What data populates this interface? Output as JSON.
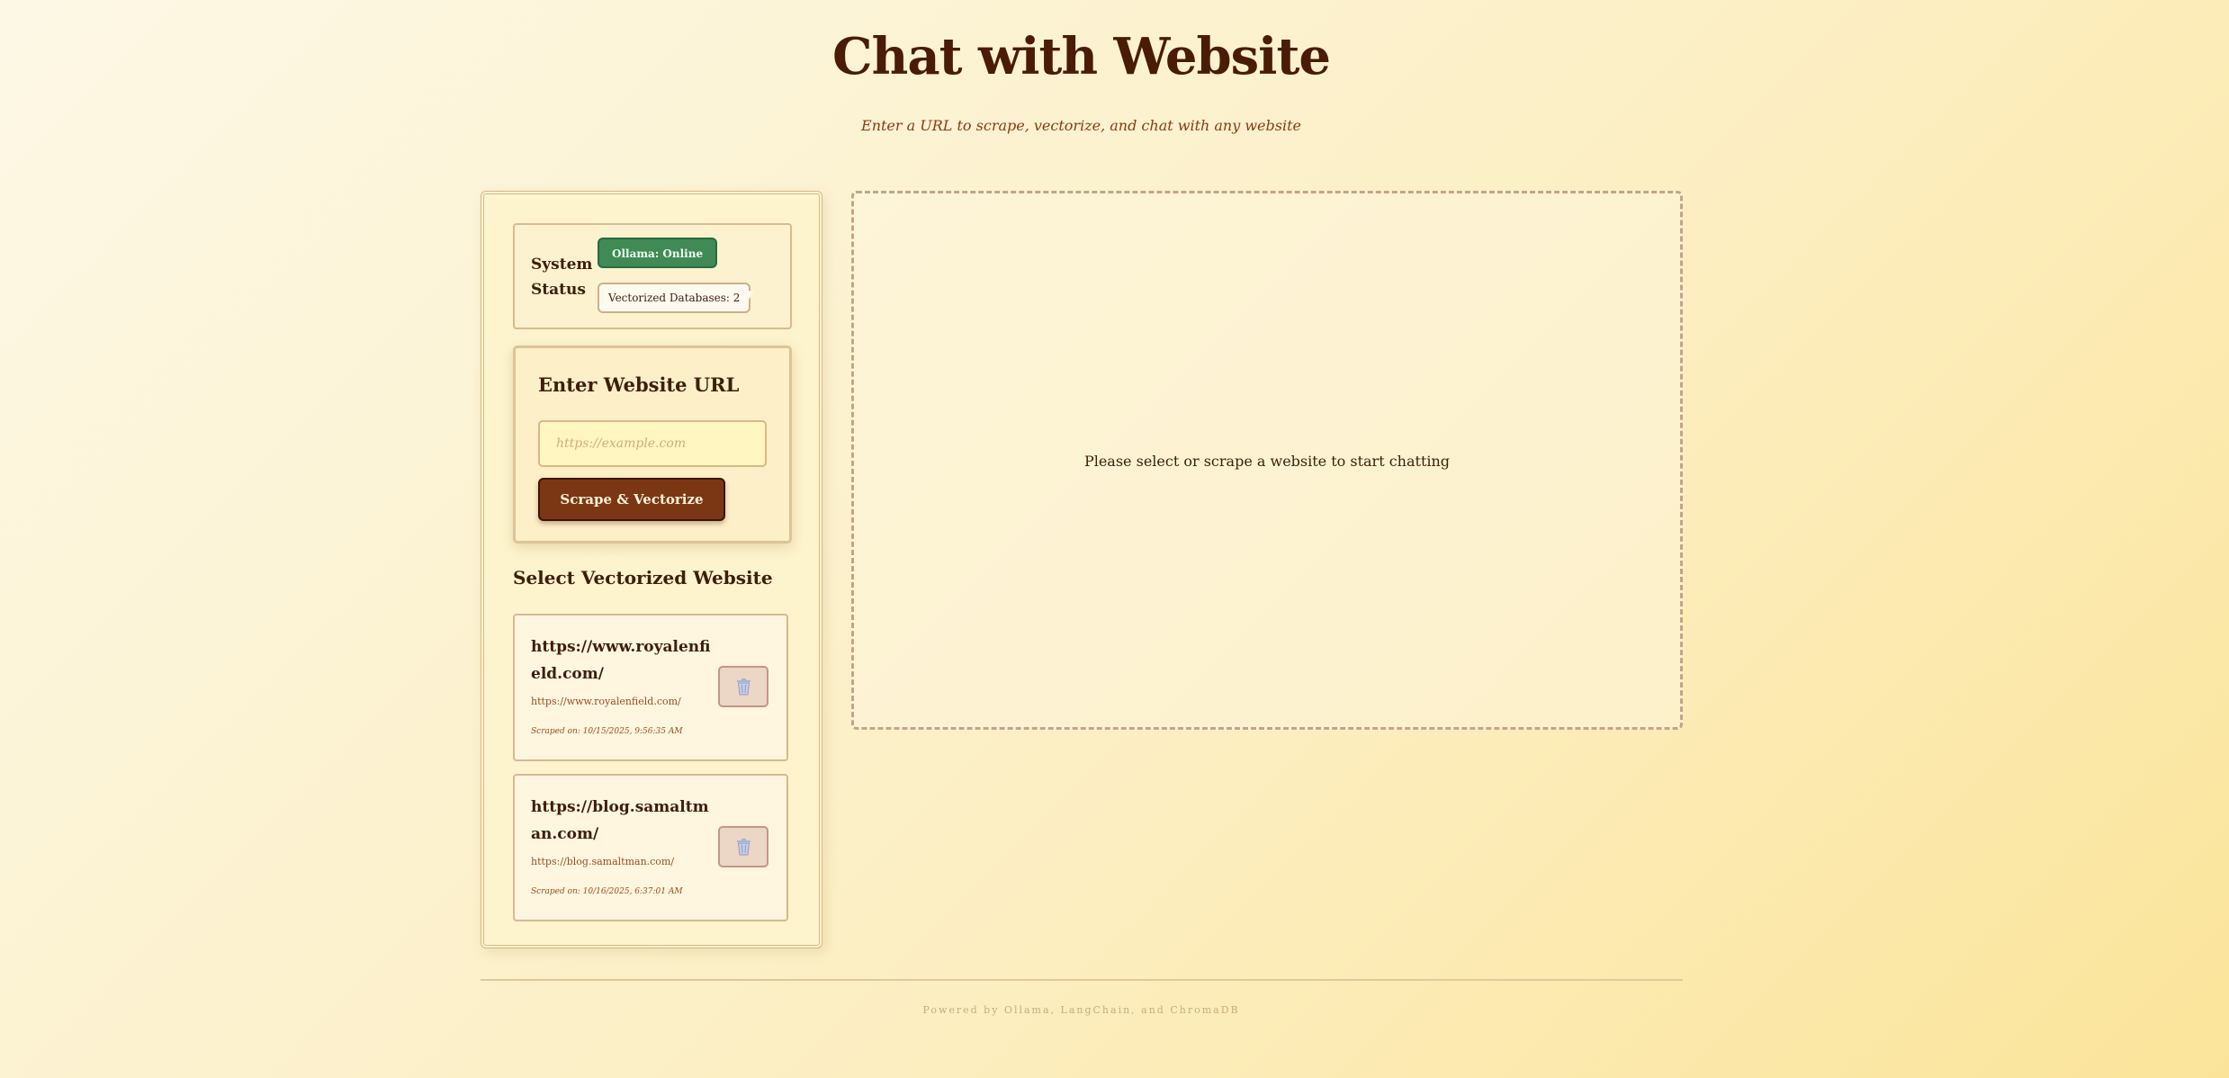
{
  "header": {
    "title": "Chat with Website",
    "subtitle": "Enter a URL to scrape, vectorize, and chat with any website"
  },
  "status": {
    "title": "System Status",
    "ollama_badge": "Ollama: Online",
    "db_badge": "Vectorized Databases: 2",
    "db_arrow_icon": "chevron-down-icon",
    "ollama_color": "#3f8a55"
  },
  "url_form": {
    "heading": "Enter Website URL",
    "placeholder": "https://example.com",
    "value": "",
    "button_label": "Scrape & Vectorize",
    "button_color": "#7b3713"
  },
  "sites": {
    "heading": "Select Vectorized Website",
    "items": [
      {
        "title": "https://www.royalenfield.com/",
        "url": "https://www.royalenfield.com/",
        "scraped": "Scraped on: 10/15/2025, 9:56:35 AM",
        "delete_icon": "trash-icon"
      },
      {
        "title": "https://blog.samaltman.com/",
        "url": "https://blog.samaltman.com/",
        "scraped": "Scraped on: 10/16/2025, 6:37:01 AM",
        "delete_icon": "trash-icon"
      }
    ]
  },
  "chat": {
    "placeholder": "Please select or scrape a website to start chatting"
  },
  "footer": {
    "text": "Powered by Ollama, LangChain, and ChromaDB"
  }
}
